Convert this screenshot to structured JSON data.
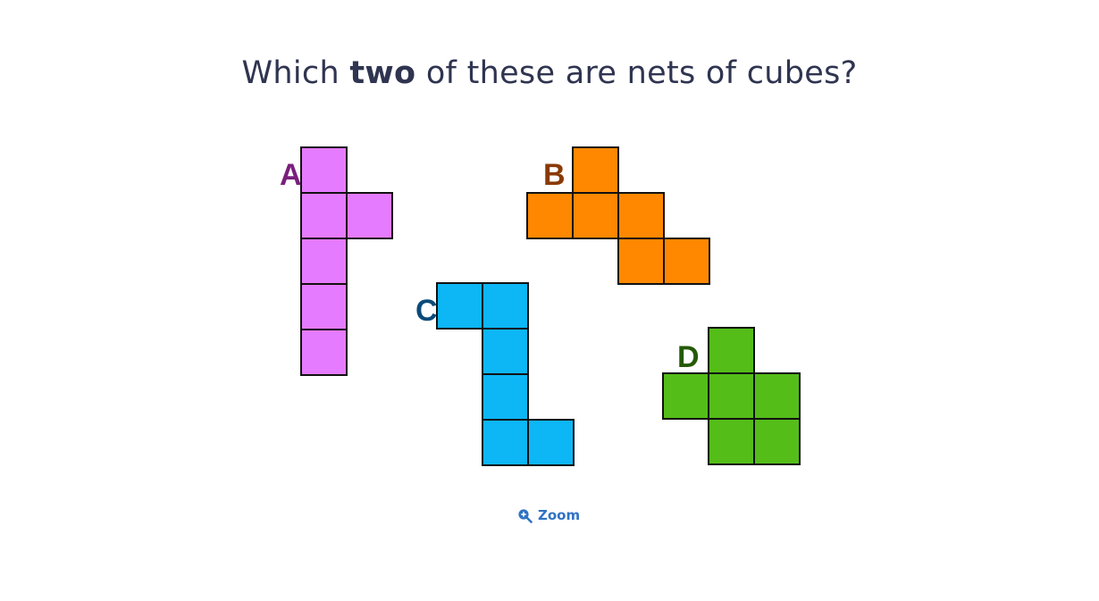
{
  "question": {
    "prefix": "Which ",
    "emphasis": "two",
    "suffix": " of these are nets of cubes?"
  },
  "nets": [
    {
      "label": "A",
      "label_color": "#7a1f7e",
      "fill": "#e57bff",
      "cells": [
        [
          0,
          0
        ],
        [
          0,
          1
        ],
        [
          1,
          1
        ],
        [
          0,
          2
        ],
        [
          0,
          3
        ],
        [
          0,
          4
        ]
      ]
    },
    {
      "label": "B",
      "label_color": "#8a3a05",
      "fill": "#ff8800",
      "cells": [
        [
          1,
          0
        ],
        [
          0,
          1
        ],
        [
          1,
          1
        ],
        [
          2,
          1
        ],
        [
          2,
          2
        ],
        [
          3,
          2
        ]
      ]
    },
    {
      "label": "C",
      "label_color": "#0b4a7a",
      "fill": "#0db6f5",
      "cells": [
        [
          0,
          0
        ],
        [
          1,
          0
        ],
        [
          1,
          1
        ],
        [
          1,
          2
        ],
        [
          1,
          3
        ],
        [
          2,
          3
        ]
      ]
    },
    {
      "label": "D",
      "label_color": "#245a05",
      "fill": "#54bd18",
      "cells": [
        [
          1,
          0
        ],
        [
          0,
          1
        ],
        [
          1,
          1
        ],
        [
          2,
          1
        ],
        [
          1,
          2
        ],
        [
          2,
          2
        ]
      ]
    }
  ],
  "zoom": {
    "label": "Zoom",
    "icon": "zoom-in-icon",
    "color": "#2f73c4"
  },
  "stroke_color": "#111111"
}
